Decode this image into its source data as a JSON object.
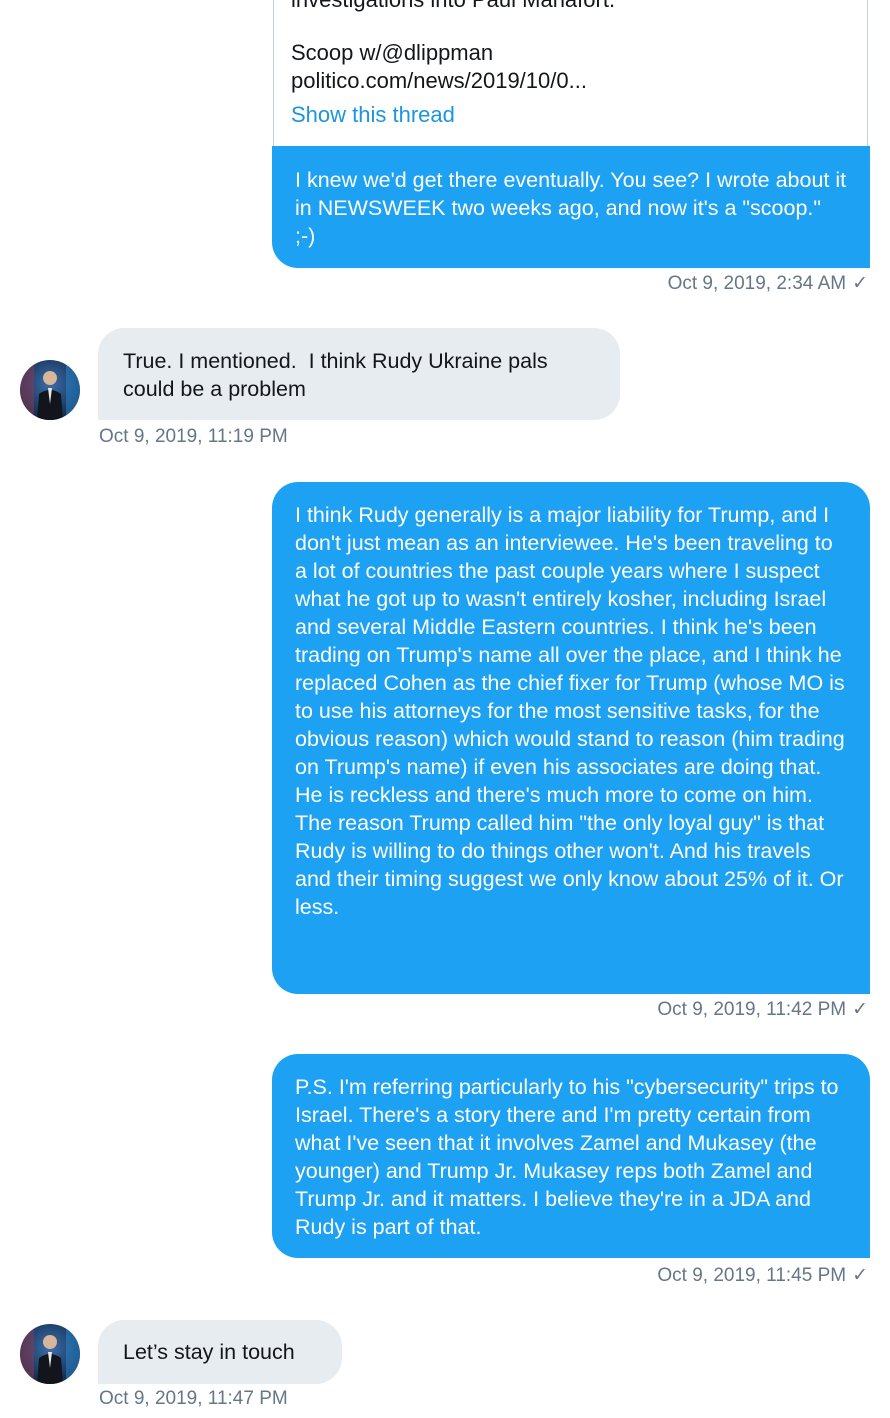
{
  "conversation": {
    "quoted_tweet": {
      "cut_line": "investigations into Paul Manafort.",
      "lines": [
        "Scoop w/@dlippman",
        "politico.com/news/2019/10/0..."
      ],
      "show_thread_label": "Show this thread"
    },
    "messages": [
      {
        "direction": "sent",
        "text": "I knew we'd get there eventually. You see? I wrote about it in NEWSWEEK two weeks ago, and now it's a \"scoop.\" ;-)",
        "timestamp": "Oct 9, 2019, 2:34 AM",
        "read_mark": "✓"
      },
      {
        "direction": "received",
        "text": "True. I mentioned.  I think Rudy Ukraine pals could be a problem",
        "timestamp": "Oct 9, 2019, 11:19 PM"
      },
      {
        "direction": "sent",
        "text": "I think Rudy generally is a major liability for Trump, and I don't just mean as an interviewee. He's been traveling to a lot of countries the past couple years where I suspect what he got up to wasn't entirely kosher, including Israel and several Middle Eastern countries. I think he's been trading on Trump's name all over the place, and I think he replaced Cohen as the chief fixer for Trump (whose MO is to use his attorneys for the most sensitive tasks, for the obvious reason) which would stand to reason (him trading on Trump's name) if even his associates are doing that. He is reckless and there's much more to come on him.  The reason Trump called him \"the only loyal guy\" is that Rudy is willing to do things other won't. And his travels and their timing suggest we only know about 25% of it. Or less.",
        "timestamp": "Oct 9, 2019, 11:42 PM",
        "read_mark": "✓"
      },
      {
        "direction": "sent",
        "text": "P.S. I'm referring particularly to his \"cybersecurity\" trips to Israel. There's a story there and I'm pretty certain from what I've seen that it involves Zamel and Mukasey (the younger) and Trump Jr. Mukasey reps both Zamel and Trump Jr. and it matters. I believe they're in a JDA and Rudy is part of that.",
        "timestamp": "Oct 9, 2019, 11:45 PM",
        "read_mark": "✓"
      },
      {
        "direction": "received",
        "text": "Let’s stay in touch",
        "timestamp": "Oct 9, 2019, 11:47 PM"
      }
    ]
  },
  "colors": {
    "sent_bubble": "#1da1f2",
    "received_bubble": "#e6ecf0",
    "link": "#1b95e0",
    "timestamp": "#657786"
  },
  "icons": {
    "avatar": "avatar-icon",
    "read_receipt": "checkmark-icon"
  }
}
